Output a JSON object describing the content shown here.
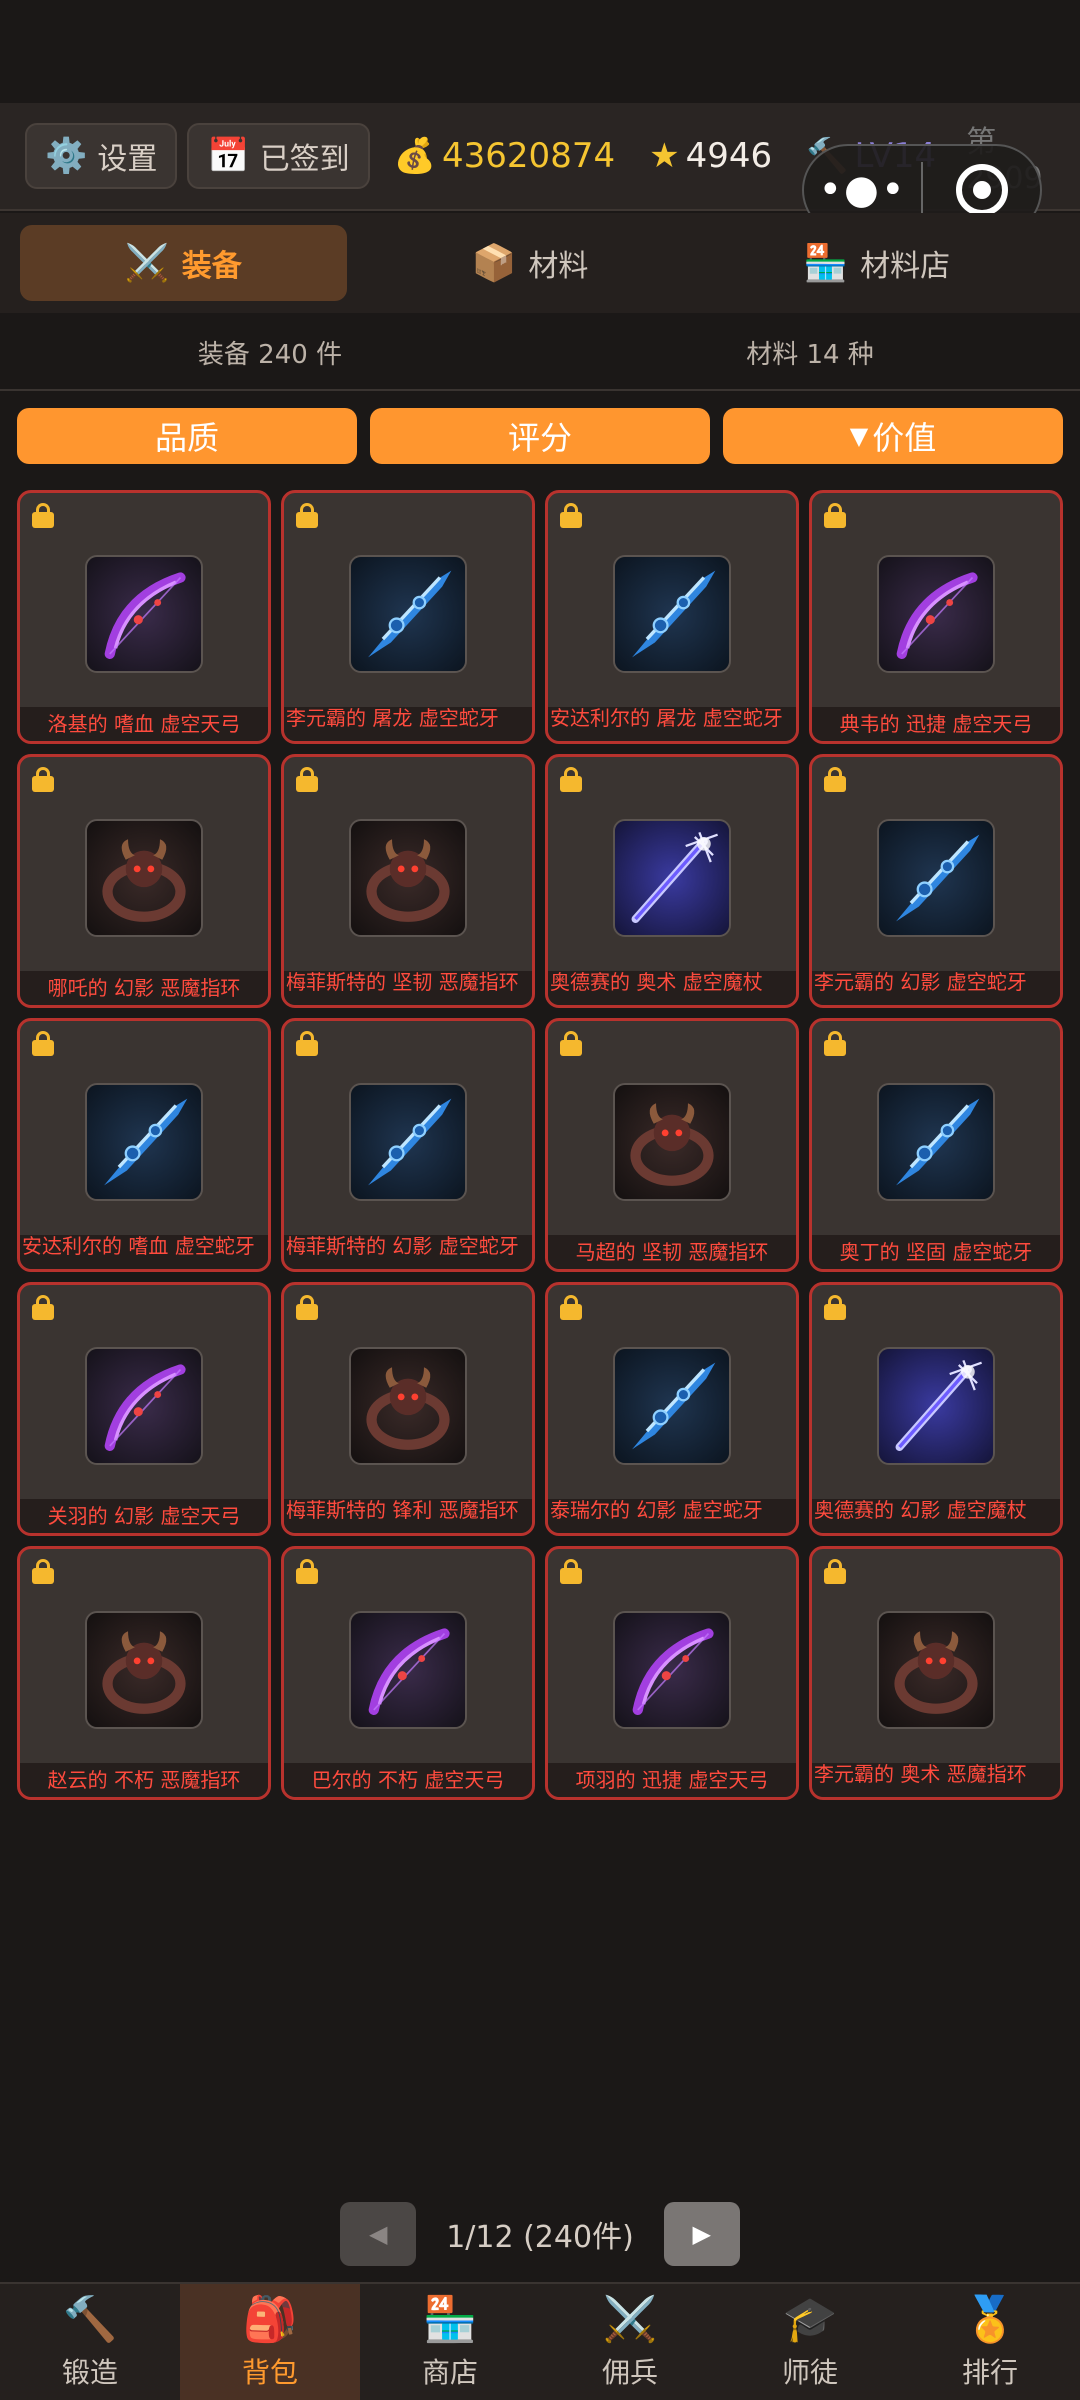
{
  "topbar": {
    "settings_label": "设置",
    "settings_icon": "gear-icon",
    "checkin_label": "已签到",
    "checkin_icon": "calendar-icon",
    "gold": "43620874",
    "stars": "4946",
    "level": "LV14",
    "rank": "第 2909"
  },
  "tabs": [
    {
      "label": "装备",
      "icon": "⚔️"
    },
    {
      "label": "材料",
      "icon": "📦"
    },
    {
      "label": "材料店",
      "icon": "🏪"
    }
  ],
  "counts": {
    "equipment": "装备 240 件",
    "materials": "材料 14 种"
  },
  "sorts": [
    {
      "label": "品质"
    },
    {
      "label": "评分"
    },
    {
      "label": "价值",
      "arrow": "▼"
    }
  ],
  "items": [
    {
      "name": "洛基的 嗜血 虚空天弓",
      "kind": "bow"
    },
    {
      "name": "李元霸的 屠龙 虚空蛇牙",
      "kind": "fang"
    },
    {
      "name": "安达利尔的 屠龙 虚空蛇牙",
      "kind": "fang"
    },
    {
      "name": "典韦的 迅捷 虚空天弓",
      "kind": "bow"
    },
    {
      "name": "哪吒的 幻影 恶魔指环",
      "kind": "ring"
    },
    {
      "name": "梅菲斯特的 坚韧 恶魔指环",
      "kind": "ring"
    },
    {
      "name": "奥德赛的 奥术 虚空魔杖",
      "kind": "staff"
    },
    {
      "name": "李元霸的 幻影 虚空蛇牙",
      "kind": "fang"
    },
    {
      "name": "安达利尔的 嗜血 虚空蛇牙",
      "kind": "fang"
    },
    {
      "name": "梅菲斯特的 幻影 虚空蛇牙",
      "kind": "fang"
    },
    {
      "name": "马超的 坚韧 恶魔指环",
      "kind": "ring"
    },
    {
      "name": "奥丁的 坚固 虚空蛇牙",
      "kind": "fang"
    },
    {
      "name": "关羽的 幻影 虚空天弓",
      "kind": "bow"
    },
    {
      "name": "梅菲斯特的 锋利 恶魔指环",
      "kind": "ring"
    },
    {
      "name": "泰瑞尔的 幻影 虚空蛇牙",
      "kind": "fang"
    },
    {
      "name": "奥德赛的 幻影 虚空魔杖",
      "kind": "staff"
    },
    {
      "name": "赵云的 不朽 恶魔指环",
      "kind": "ring"
    },
    {
      "name": "巴尔的 不朽 虚空天弓",
      "kind": "bow"
    },
    {
      "name": "项羽的 迅捷 虚空天弓",
      "kind": "bow"
    },
    {
      "name": "李元霸的 奥术 恶魔指环",
      "kind": "ring"
    }
  ],
  "pager": {
    "text": "1/12 (240件)",
    "prev": "◀",
    "next": "▶"
  },
  "nav": [
    {
      "label": "锻造",
      "icon": "🔨"
    },
    {
      "label": "背包",
      "icon": "🎒"
    },
    {
      "label": "商店",
      "icon": "🏪"
    },
    {
      "label": "佣兵",
      "icon": "⚔️"
    },
    {
      "label": "师徒",
      "icon": "🎓"
    },
    {
      "label": "排行",
      "icon": "🏅"
    }
  ],
  "colors": {
    "accent": "#ff962f",
    "card_border": "#b8322d",
    "item_name": "#ff4b3e",
    "gold": "#f5c531"
  }
}
